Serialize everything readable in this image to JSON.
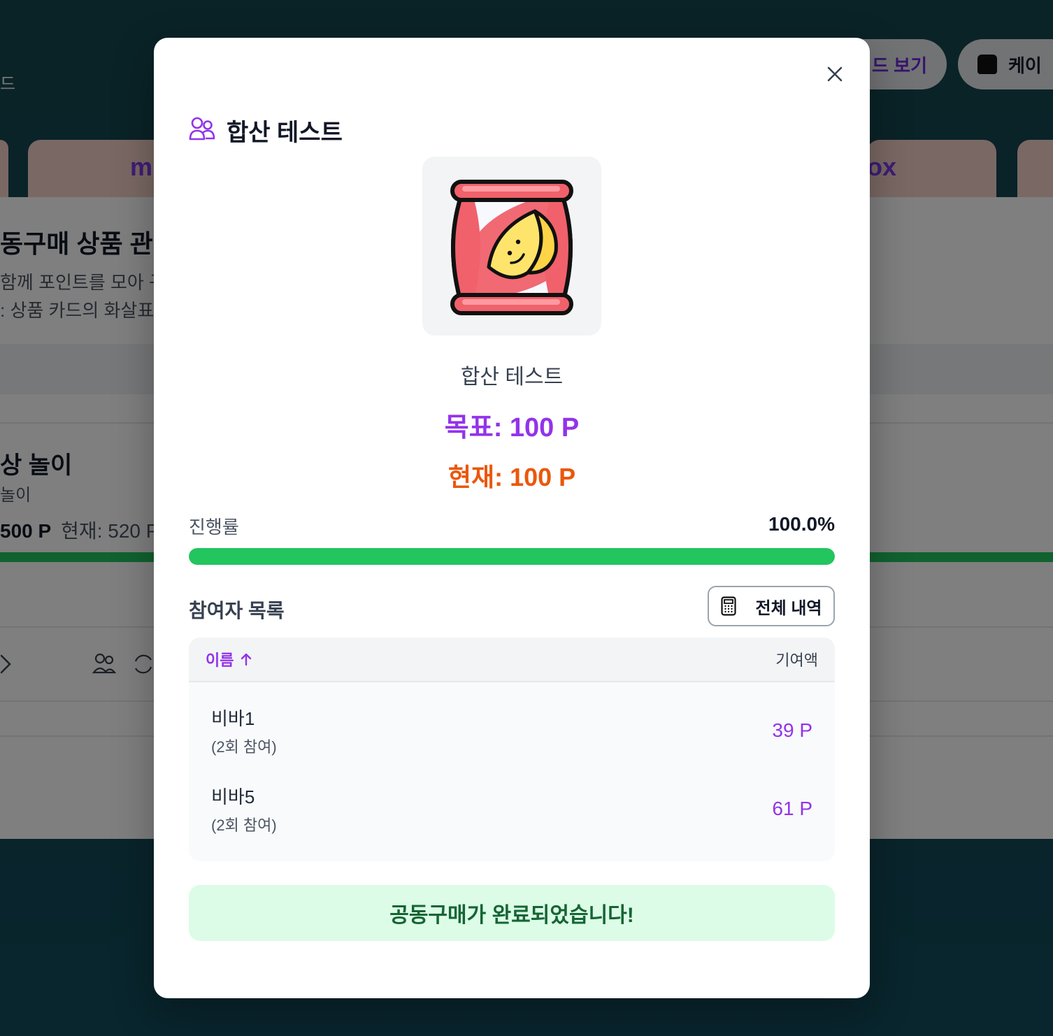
{
  "background": {
    "header_partial_text": "드",
    "view_button_label": "드 보기",
    "cake_button_label": "케이",
    "banner_left_word": "m",
    "banner_right_word": "ox",
    "page_title": "동구매 상품 관리",
    "page_desc_line1": "함께 포인트를 모아 구",
    "page_desc_line2": ": 상품 카드의 화살표",
    "card_title": "상 놀이",
    "card_subtitle": "놀이",
    "card_goal": "500 P",
    "card_current": "현재: 520 P"
  },
  "modal": {
    "title": "합산 테스트",
    "product_name": "합산 테스트",
    "goal_text": "목표: 100 P",
    "current_text": "현재: 100 P",
    "progress_label": "진행률",
    "progress_value": "100.0%",
    "progress_fraction": 1.0,
    "participants_label": "참여자 목록",
    "history_button_label": "전체 내역",
    "table": {
      "col_name": "이름",
      "col_amount": "기여액",
      "rows": [
        {
          "name": "비바1",
          "sub": "(2회 참여)",
          "amount": "39 P"
        },
        {
          "name": "비바5",
          "sub": "(2회 참여)",
          "amount": "61 P"
        }
      ]
    },
    "done_message": "공동구매가 완료되었습니다!"
  },
  "colors": {
    "accent_purple": "#9333ea",
    "current_orange": "#ea580c",
    "progress_green": "#22c55e",
    "done_bg": "#dcfce7",
    "done_text": "#166534"
  }
}
